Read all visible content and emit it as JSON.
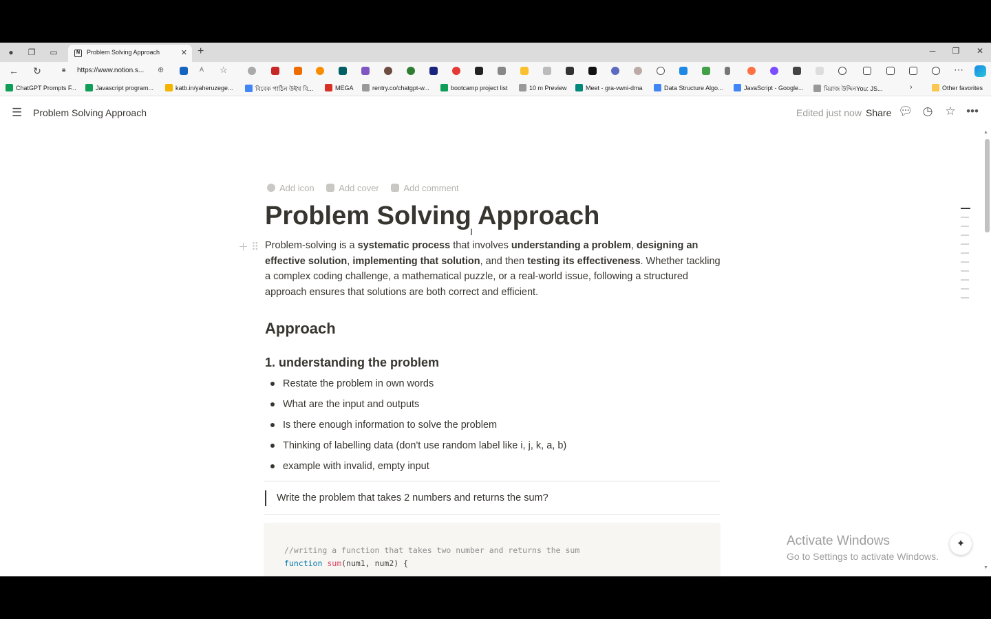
{
  "browser": {
    "tab_title": "Problem Solving Approach",
    "url": "https://www.notion.s...",
    "bookmarks": [
      {
        "label": "ChatGPT Prompts F...",
        "color": "#0f9d58"
      },
      {
        "label": "Javascript program...",
        "color": "#0f9d58"
      },
      {
        "label": "katb.in/yaheruzege...",
        "color": "#f4b400"
      },
      {
        "label": "বিবেক পাঠিন উইথ বি...",
        "color": "#4285f4"
      },
      {
        "label": "MEGA",
        "color": "#d93025"
      },
      {
        "label": "rentry.co/chatgpt-w...",
        "color": "#999999"
      },
      {
        "label": "bootcamp project list",
        "color": "#0f9d58"
      },
      {
        "label": "10 m Preview",
        "color": "#999999"
      },
      {
        "label": "Meet - gra-vwni-dma",
        "color": "#00897b"
      },
      {
        "label": "Data Structure Algo...",
        "color": "#4285f4"
      },
      {
        "label": "JavaScript - Google...",
        "color": "#4285f4"
      },
      {
        "label": "মিরাজ উদ্দিনYou: JS...",
        "color": "#999999"
      }
    ],
    "other_favorites": "Other favorites"
  },
  "header": {
    "breadcrumb": "Problem Solving Approach",
    "edited": "Edited just now",
    "share": "Share"
  },
  "page": {
    "actions": [
      "Add icon",
      "Add cover",
      "Add comment"
    ],
    "title": "Problem Solving Approach",
    "intro": {
      "p1": "Problem-solving is a ",
      "b1": "systematic process",
      "p2": " that involves ",
      "b2": "understanding a problem",
      "p3": ", ",
      "b3": "designing an effective solution",
      "p4": ", ",
      "b4": "implementing that solution",
      "p5": ", and then ",
      "b5": "testing its effectiveness",
      "p6": ". Whether tackling a complex coding challenge, a mathematical puzzle, or a real-world issue, following a structured approach ensures that solutions are both correct and efficient."
    },
    "heading": "Approach",
    "subheading": "1. understanding the problem",
    "bullets": [
      "Restate the problem in own words",
      "What are the input and outputs",
      "Is there enough information to solve the problem",
      "Thinking of labelling data (don't use random label like i, j, k, a, b)",
      "example with invalid, empty input"
    ],
    "quote": "Write the problem that takes 2 numbers and returns the sum?",
    "code": {
      "comment": "//writing a function that takes two number and returns the sum",
      "kw": "function",
      "fn": "sum",
      "rest": "(num1, num2) {"
    }
  },
  "watermark": {
    "line1": "Activate Windows",
    "line2": "Go to Settings to activate Windows."
  }
}
